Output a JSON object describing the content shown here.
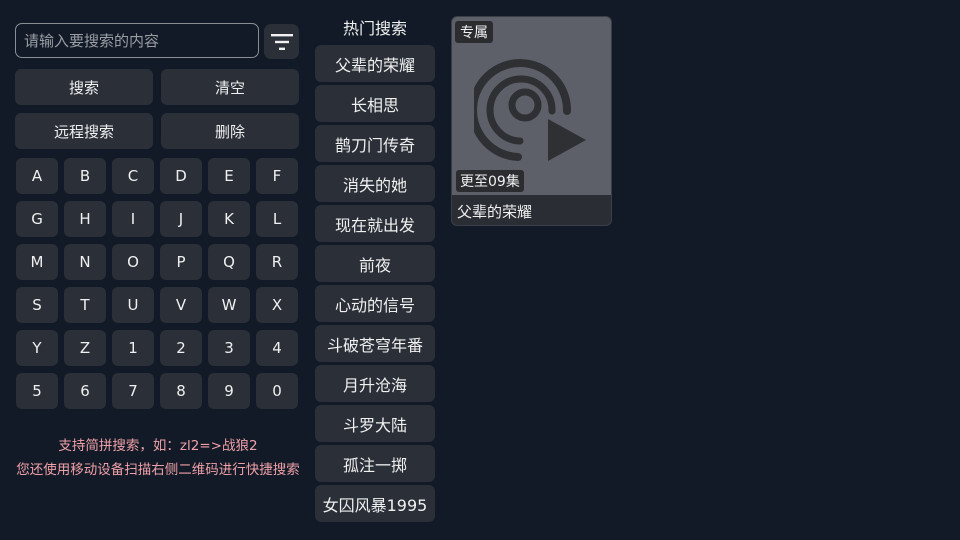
{
  "search": {
    "placeholder": "请输入要搜索的内容",
    "value": "",
    "filter_icon": "filter-icon"
  },
  "actions": {
    "search_label": "搜索",
    "clear_label": "清空",
    "remote_search_label": "远程搜索",
    "delete_label": "删除"
  },
  "keyboard": {
    "keys": [
      "A",
      "B",
      "C",
      "D",
      "E",
      "F",
      "G",
      "H",
      "I",
      "J",
      "K",
      "L",
      "M",
      "N",
      "O",
      "P",
      "Q",
      "R",
      "S",
      "T",
      "U",
      "V",
      "W",
      "X",
      "Y",
      "Z",
      "1",
      "2",
      "3",
      "4",
      "5",
      "6",
      "7",
      "8",
      "9",
      "0"
    ]
  },
  "tip": {
    "line1": "支持简拼搜索，如：zl2=>战狼2",
    "line2": "您还使用移动设备扫描右侧二维码进行快捷搜索"
  },
  "hot": {
    "title": "热门搜索",
    "items": [
      "父辈的荣耀",
      "长相思",
      "鹊刀门传奇",
      "消失的她",
      "现在就出发",
      "前夜",
      "心动的信号",
      "斗破苍穹年番",
      "月升沧海",
      "斗罗大陆",
      "孤注一掷",
      "女囚风暴1995"
    ]
  },
  "result": {
    "badge_exclusive": "专属",
    "badge_update": "更至09集",
    "title": "父辈的荣耀",
    "poster_icon": "vinyl-play-icon"
  },
  "colors": {
    "background": "#111a26",
    "button": "#2a2f38",
    "tip_text": "#f0a0a8",
    "poster_placeholder": "#5d6068"
  }
}
